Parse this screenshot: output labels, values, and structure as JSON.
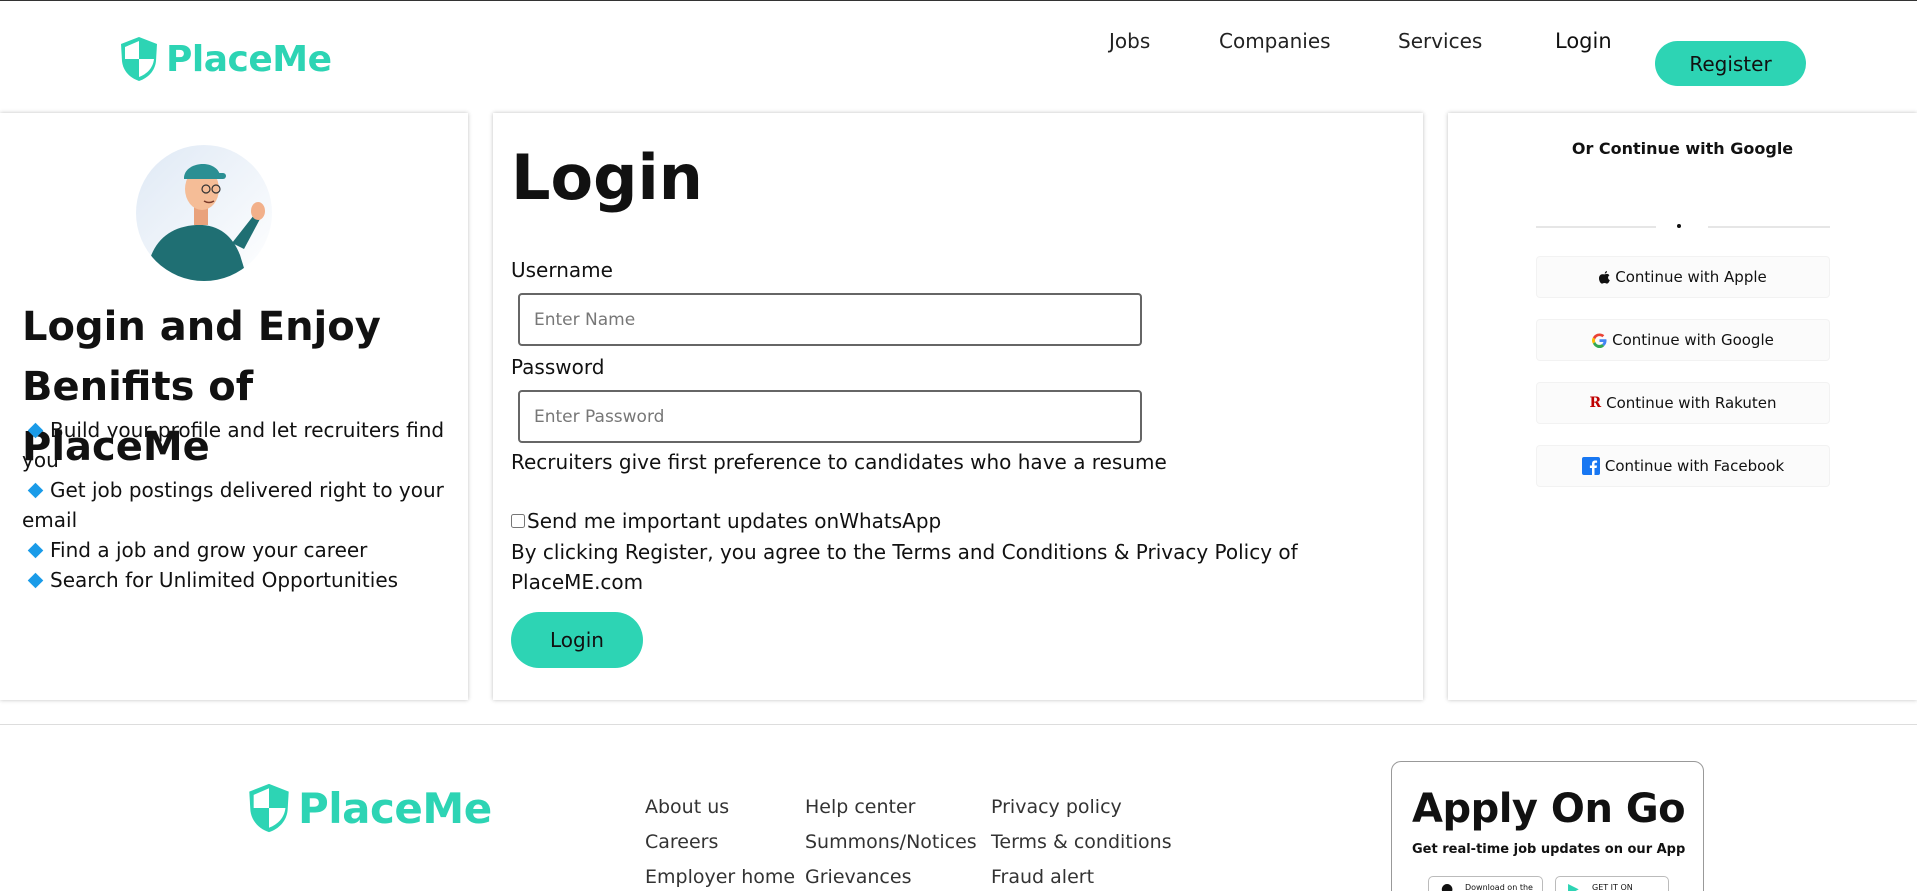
{
  "brand": {
    "name": "PlaceMe",
    "accent_color": "#2dd4b4",
    "bullet_color": "#1a9be8"
  },
  "header": {
    "nav": {
      "jobs": "Jobs",
      "companies": "Companies",
      "services": "Services",
      "login": "Login"
    },
    "register_label": "Register"
  },
  "left_panel": {
    "avatar_icon": "waving-person-avatar",
    "title": "Login and Enjoy Benifits of PlaceMe",
    "benefits": [
      "Build your profile and let recruiters find you",
      "Get job postings delivered right to your email",
      "Find a job and grow your career",
      "Search for Unlimited Opportunities"
    ]
  },
  "login_form": {
    "title": "Login",
    "username_label": "Username",
    "username_placeholder": "Enter Name",
    "username_value": "",
    "password_label": "Password",
    "password_placeholder": "Enter Password",
    "password_value": "",
    "resume_note": "Recruiters give first preference to candidates who have a resume",
    "whatsapp_label": "Send me important updates onWhatsApp",
    "whatsapp_checked": false,
    "terms_text": "By clicking Register, you agree to the Terms and Conditions & Privacy Policy of PlaceME.com",
    "login_button": "Login"
  },
  "social": {
    "heading": "Or Continue with Google",
    "buttons": [
      {
        "label": "Continue with Apple",
        "icon": "apple-icon"
      },
      {
        "label": "Continue with Google",
        "icon": "google-icon"
      },
      {
        "label": "Continue with Rakuten",
        "icon": "rakuten-icon"
      },
      {
        "label": "Continue with Facebook",
        "icon": "facebook-icon"
      }
    ]
  },
  "footer": {
    "col1": [
      "About us",
      "Careers",
      "Employer home"
    ],
    "col2": [
      "Help center",
      "Summons/Notices",
      "Grievances"
    ],
    "col3": [
      "Privacy policy",
      "Terms & conditions",
      "Fraud alert"
    ],
    "app": {
      "title": "Apply On Go",
      "subtitle": "Get real-time job updates on our App",
      "app_store": "Download on the",
      "play_store": "GET IT ON"
    }
  }
}
